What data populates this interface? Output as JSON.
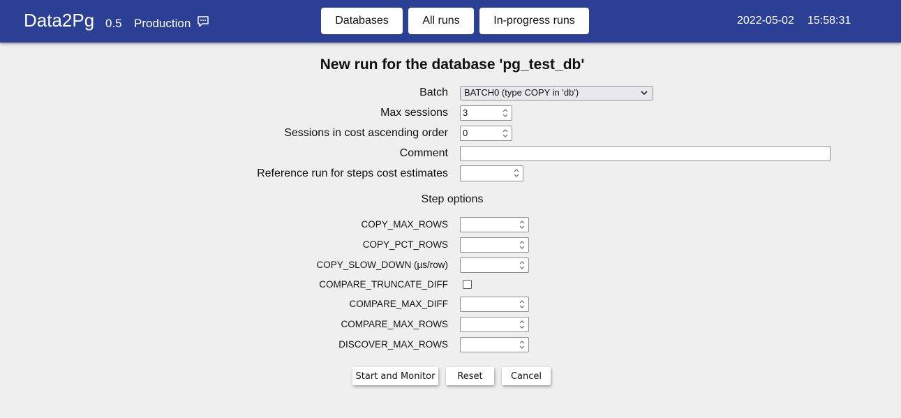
{
  "header": {
    "app_name": "Data2Pg",
    "version": "0.5",
    "environment": "Production",
    "comment_icon": "message-icon",
    "nav": {
      "databases": "Databases",
      "all_runs": "All runs",
      "in_progress_runs": "In-progress runs"
    },
    "date": "2022-05-02",
    "time": "15:58:31",
    "accent_color": "#2b3f94"
  },
  "form": {
    "title": "New run for the database 'pg_test_db'",
    "batch": {
      "label": "Batch",
      "selected": "BATCH0 (type COPY in 'db')"
    },
    "max_sessions": {
      "label": "Max sessions",
      "value": "3"
    },
    "sessions_order": {
      "label": "Sessions in cost ascending order",
      "value": "0"
    },
    "comment": {
      "label": "Comment",
      "value": ""
    },
    "reference_run": {
      "label": "Reference run for steps cost estimates",
      "value": ""
    },
    "step_options_title": "Step options",
    "step_options": {
      "copy_max_rows": "COPY_MAX_ROWS",
      "copy_pct_rows": "COPY_PCT_ROWS",
      "copy_slow_down": "COPY_SLOW_DOWN (µs/row)",
      "compare_truncate_diff": "COMPARE_TRUNCATE_DIFF",
      "compare_max_diff": "COMPARE_MAX_DIFF",
      "compare_max_rows": "COMPARE_MAX_ROWS",
      "discover_max_rows": "DISCOVER_MAX_ROWS"
    },
    "actions": {
      "start": "Start and Monitor",
      "reset": "Reset",
      "cancel": "Cancel"
    }
  }
}
